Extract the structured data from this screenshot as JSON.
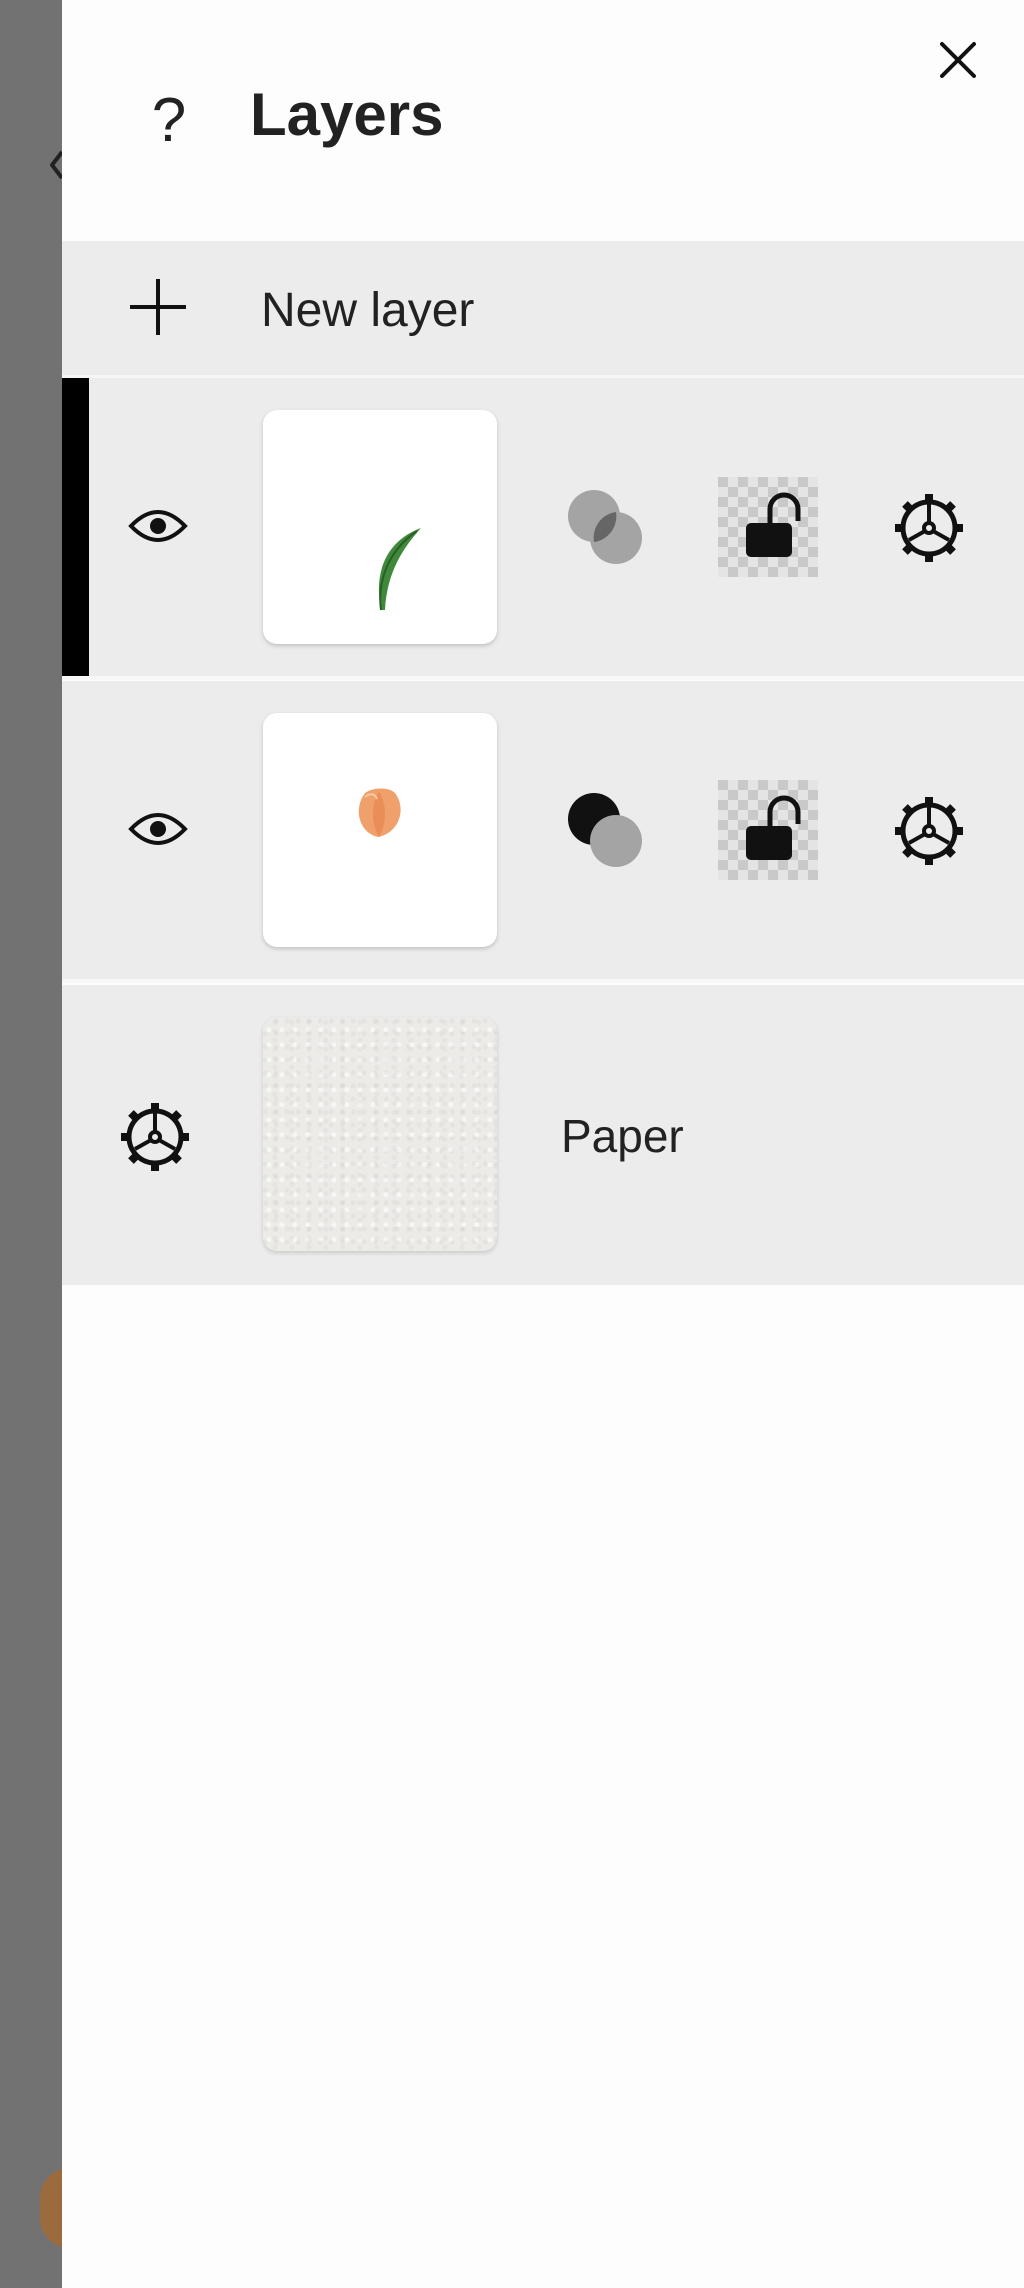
{
  "panel": {
    "title": "Layers",
    "help_icon": "?",
    "close_icon": "close-icon"
  },
  "new_layer": {
    "label": "New layer",
    "icon": "plus-icon"
  },
  "layers": [
    {
      "thumbnail": "leaf-stroke",
      "selected": true,
      "visible": true,
      "blend_icon": "blend-mode-icon",
      "lock_icon": "alpha-lock-unlocked-icon",
      "settings_icon": "gear-icon",
      "colors": {
        "leaf": "#3f8a3a"
      }
    },
    {
      "thumbnail": "tulip-bud",
      "selected": false,
      "visible": true,
      "blend_icon": "blend-mode-icon",
      "lock_icon": "alpha-lock-unlocked-icon",
      "settings_icon": "gear-icon",
      "colors": {
        "petal": "#f0a06a"
      }
    }
  ],
  "paper": {
    "label": "Paper",
    "settings_icon": "gear-icon"
  },
  "colors": {
    "panel_bg": "#fdfdfd",
    "row_bg": "#ececec",
    "selection": "#000000",
    "backdrop": "#727272"
  }
}
